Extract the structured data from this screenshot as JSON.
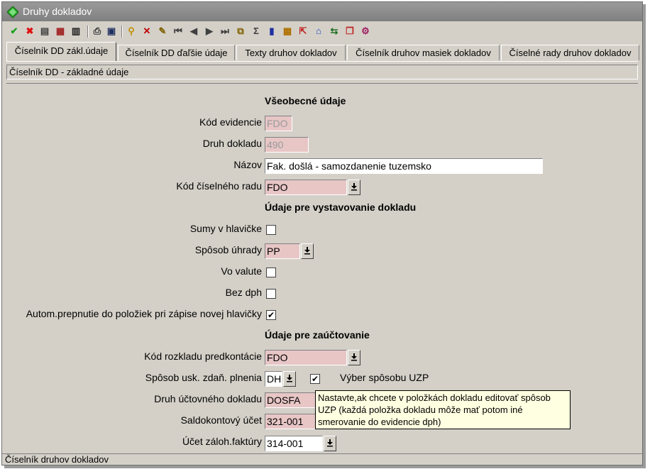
{
  "window": {
    "title": "Druhy dokladov"
  },
  "toolbar": {
    "buttons": [
      {
        "name": "confirm-icon",
        "glyph": "✔",
        "color": "#1aa01a"
      },
      {
        "name": "cancel-icon",
        "glyph": "✖",
        "color": "#e01010"
      },
      {
        "name": "insert-record-icon",
        "glyph": "▤",
        "color": "#404040"
      },
      {
        "name": "copy-record-icon",
        "glyph": "▦",
        "color": "#a02020"
      },
      {
        "name": "delete-record-icon",
        "glyph": "▥",
        "color": "#202020"
      },
      {
        "name": "print-icon",
        "glyph": "⎙",
        "color": "#303030"
      },
      {
        "name": "preview-icon",
        "glyph": "▣",
        "color": "#203060"
      },
      {
        "name": "filter-icon",
        "glyph": "⚲",
        "color": "#c09000"
      },
      {
        "name": "clear-filter-icon",
        "glyph": "✕",
        "color": "#c00000"
      },
      {
        "name": "filter-select-icon",
        "glyph": "✎",
        "color": "#806000"
      },
      {
        "name": "first-record-icon",
        "glyph": "⏮",
        "color": "#404040"
      },
      {
        "name": "prev-record-icon",
        "glyph": "◀",
        "color": "#404040"
      },
      {
        "name": "next-record-icon",
        "glyph": "▶",
        "color": "#404040"
      },
      {
        "name": "last-record-icon",
        "glyph": "⏭",
        "color": "#404040"
      },
      {
        "name": "find-icon",
        "glyph": "⧉",
        "color": "#806000"
      },
      {
        "name": "sum-icon",
        "glyph": "Σ",
        "color": "#404040"
      },
      {
        "name": "book-icon",
        "glyph": "▮",
        "color": "#2030a0"
      },
      {
        "name": "calendar-icon",
        "glyph": "▩",
        "color": "#b07000"
      },
      {
        "name": "export-icon",
        "glyph": "⇱",
        "color": "#c02020"
      },
      {
        "name": "home-icon",
        "glyph": "⌂",
        "color": "#2040c0"
      },
      {
        "name": "transfer-icon",
        "glyph": "⇆",
        "color": "#207020"
      },
      {
        "name": "windows-icon",
        "glyph": "❐",
        "color": "#c02020"
      },
      {
        "name": "settings-icon",
        "glyph": "⚙",
        "color": "#a02060"
      }
    ]
  },
  "tabs": [
    {
      "label": "Číselník DD zákl.údaje",
      "active": true
    },
    {
      "label": "Číselník DD ďaľšie údaje"
    },
    {
      "label": "Texty druhov dokladov"
    },
    {
      "label": "Číselník druhov masiek dokladov"
    },
    {
      "label": "Číselné rady druhov dokladov"
    }
  ],
  "panel": {
    "header": "Číselník DD - základné údaje"
  },
  "form": {
    "section_general": "Všeobecné údaje",
    "kod_evidencie": {
      "label": "Kód evidencie",
      "value": "FDO"
    },
    "druh_dokladu": {
      "label": "Druh dokladu",
      "value": "490"
    },
    "nazov": {
      "label": "Názov",
      "value": "Fak. došlá - samozdanenie tuzemsko"
    },
    "kod_ciselneho_radu": {
      "label": "Kód číselného radu",
      "value": "FDO"
    },
    "section_issue": "Údaje pre vystavovanie dokladu",
    "sumy_v_hlavicke": {
      "label": "Sumy v hlavičke",
      "checked": false
    },
    "sposob_uhrady": {
      "label": "Spôsob úhrady",
      "value": "PP"
    },
    "vo_valute": {
      "label": "Vo valute",
      "checked": false
    },
    "bez_dph": {
      "label": "Bez dph",
      "checked": false
    },
    "autom_prepnutie": {
      "label": "Autom.prepnutie do položiek pri zápise novej hlavičky",
      "checked": true
    },
    "section_accounting": "Údaje pre zaúčtovanie",
    "kod_rozkladu": {
      "label": "Kód rozkladu predkontácie",
      "value": "FDO"
    },
    "sposob_usk": {
      "label": "Spôsob usk. zdaň. plnenia",
      "value": "DH"
    },
    "vyber_uzp": {
      "label": "Výber spôsobu UZP",
      "checked": true
    },
    "druh_uctovneho": {
      "label": "Druh účtovného dokladu",
      "value": "DOSFA"
    },
    "saldokontovy_ucet": {
      "label": "Saldokontový účet",
      "value": "321-001"
    },
    "ucet_zaloh": {
      "label": "Účet záloh.faktúry",
      "value": "314-001"
    }
  },
  "tooltip": {
    "text": "Nastavte,ak chcete v položkách dokladu editovať spôsob UZP (každá položka dokladu môže mať potom iné smerovanie do  evidencie dph)"
  },
  "statusbar": {
    "text": "Číselník druhov dokladov"
  },
  "check_mark": "✔"
}
